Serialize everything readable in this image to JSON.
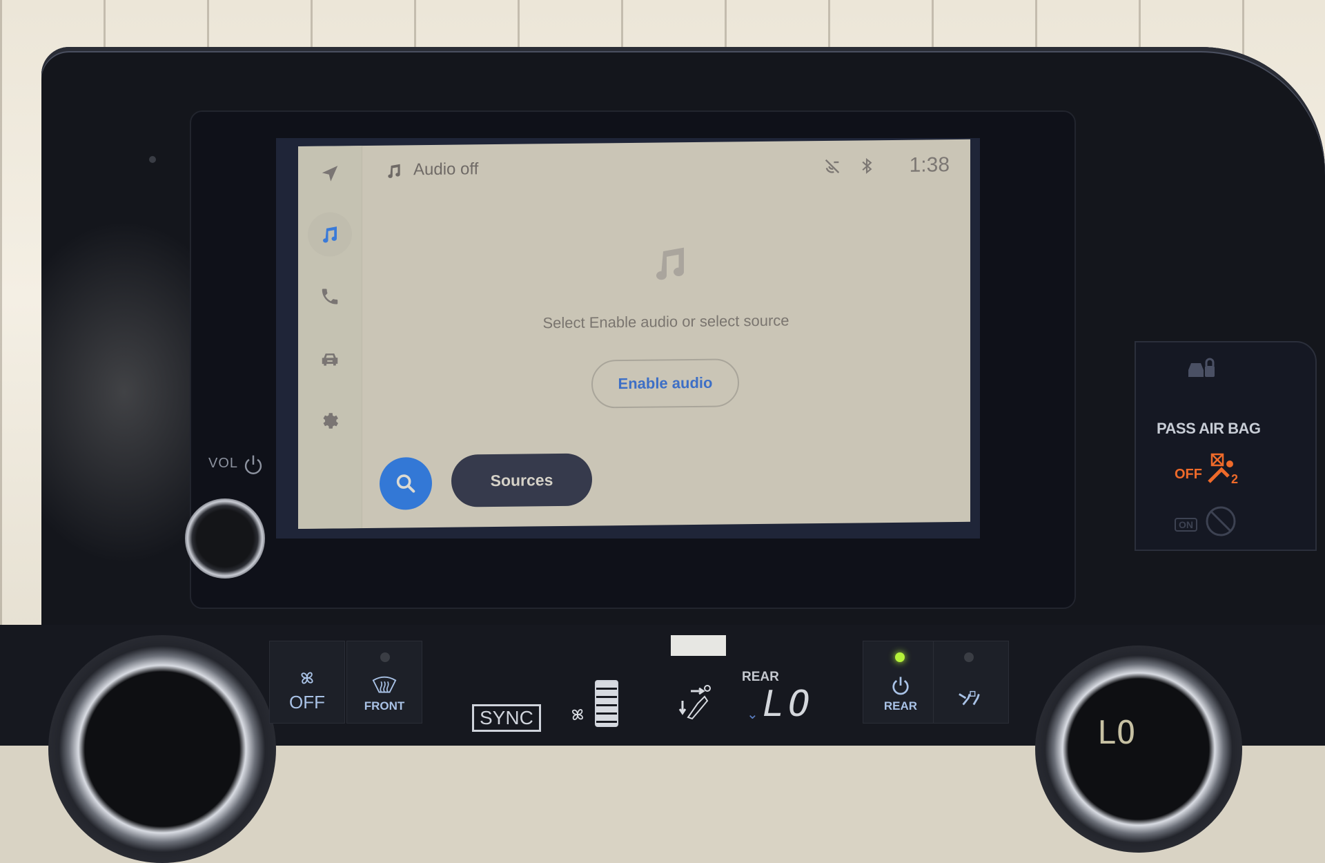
{
  "screen": {
    "title": "Audio off",
    "status": {
      "clock": "1:38",
      "icons": [
        "voice-muted-icon",
        "bluetooth-icon"
      ]
    },
    "rail": [
      {
        "name": "navigation",
        "icon": "navigation-arrow-icon",
        "active": false
      },
      {
        "name": "audio",
        "icon": "music-note-icon",
        "active": true
      },
      {
        "name": "phone",
        "icon": "phone-icon",
        "active": false
      },
      {
        "name": "vehicle",
        "icon": "car-icon",
        "active": false
      },
      {
        "name": "settings",
        "icon": "gear-icon",
        "active": false
      }
    ],
    "hint": "Select Enable audio or select source",
    "enable_audio_label": "Enable audio",
    "sources_label": "Sources",
    "colors": {
      "background": "#cac5b6",
      "accent": "#3378d6",
      "link_text": "#3d6fc6",
      "sources_button": "#363a4c"
    }
  },
  "hardware": {
    "volume_label": "VOL",
    "airbag": {
      "title": "PASS AIR BAG",
      "off_label": "OFF",
      "off_seat_number": "2",
      "on_label": "ON",
      "off_color": "#ee6a2a"
    },
    "climate": {
      "fan_off_label": "OFF",
      "front_defrost_label": "FRONT",
      "sync_label": "SYNC",
      "rear_label": "REAR",
      "rear_temp": "LO",
      "rear_power_label": "REAR",
      "right_knob_temp": "LO"
    }
  }
}
